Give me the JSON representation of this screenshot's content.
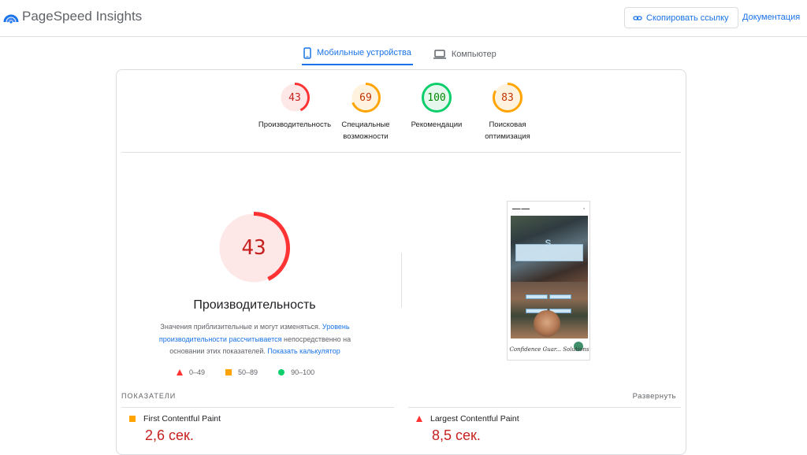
{
  "header": {
    "brand": "PageSpeed Insights",
    "copy_link": "Скопировать ссылку",
    "docs": "Документация"
  },
  "tabs": [
    {
      "label": "Мобильные устройства",
      "active": true
    },
    {
      "label": "Компьютер",
      "active": false
    }
  ],
  "scores": [
    {
      "value": "43",
      "label": "Производительность",
      "color": "#ff3333",
      "fraction": 0.43
    },
    {
      "value": "69",
      "label": "Специальные возможности",
      "color": "#ffa400",
      "fraction": 0.69
    },
    {
      "value": "100",
      "label": "Рекомендации",
      "color": "#0cce6b",
      "fraction": 1.0
    },
    {
      "value": "83",
      "label": "Поисковая оптимизация",
      "color": "#ffa400",
      "fraction": 0.83
    }
  ],
  "performance": {
    "score": "43",
    "fraction": 0.43,
    "title": "Производительность",
    "desc_part1": "Значения приблизительные и могут изменяться. ",
    "desc_link1": "Уровень производительности рассчитывается",
    "desc_part2": " непосредственно на основании этих показателей. ",
    "desc_link2": "Показать калькулятор"
  },
  "legend": [
    {
      "range": "0–49",
      "icon": "triangle-icon"
    },
    {
      "range": "50–89",
      "icon": "square-icon"
    },
    {
      "range": "90–100",
      "icon": "circle-icon"
    }
  ],
  "screenshot": {
    "caption": "Confidence Guar... Solutions"
  },
  "metrics": {
    "label": "ПОКАЗАТЕЛИ",
    "expand": "Развернуть",
    "items": [
      {
        "name": "First Contentful Paint",
        "value": "2,6 сек.",
        "status": "average"
      },
      {
        "name": "Largest Contentful Paint",
        "value": "8,5 сек.",
        "status": "fail"
      }
    ]
  },
  "colors": {
    "accent": "#1a73e8",
    "fail": "#ff3333",
    "average": "#ffa400",
    "pass": "#0cce6b"
  }
}
